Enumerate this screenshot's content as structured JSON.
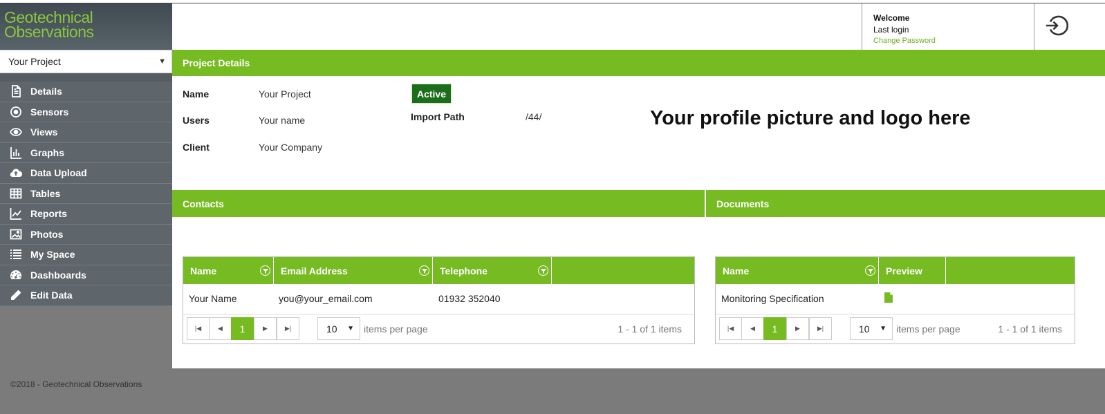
{
  "app": {
    "logo_line1": "Geotechnical",
    "logo_line2": "Observations",
    "footer": "©2018 - Geotechnical Observations"
  },
  "colors": {
    "accent": "#77bb22",
    "status_active": "#1c6d1c",
    "sidebar": "#5e666c",
    "link": "#6fae22"
  },
  "sidebar": {
    "project_select": "Your Project",
    "items": [
      {
        "label": "Details",
        "icon": "document-icon"
      },
      {
        "label": "Sensors",
        "icon": "target-icon"
      },
      {
        "label": "Views",
        "icon": "eye-icon"
      },
      {
        "label": "Graphs",
        "icon": "bar-chart-icon"
      },
      {
        "label": "Data Upload",
        "icon": "cloud-upload-icon"
      },
      {
        "label": "Tables",
        "icon": "table-icon"
      },
      {
        "label": "Reports",
        "icon": "line-chart-icon"
      },
      {
        "label": "Photos",
        "icon": "image-icon"
      },
      {
        "label": "My Space",
        "icon": "list-icon"
      },
      {
        "label": "Dashboards",
        "icon": "dashboard-icon"
      },
      {
        "label": "Edit Data",
        "icon": "pencil-icon"
      }
    ]
  },
  "header": {
    "welcome": "Welcome",
    "last_login": "Last login",
    "change_password": "Change Password",
    "logout_icon": "sign-in-icon"
  },
  "project_details": {
    "title": "Project Details",
    "name_label": "Name",
    "name_value": "Your Project",
    "users_label": "Users",
    "users_value": "Your name",
    "client_label": "Client",
    "client_value": "Your Company",
    "status": "Active",
    "import_path_label": "Import Path",
    "import_path_value": "/44/",
    "profile_placeholder": "Your profile picture and logo here"
  },
  "contacts": {
    "title": "Contacts",
    "columns": [
      "Name",
      "Email Address",
      "Telephone"
    ],
    "rows": [
      {
        "name": "Your Name",
        "email": "you@your_email.com",
        "phone": "01932 352040"
      }
    ],
    "page": "1",
    "page_size": "10",
    "items_per_page": "items per page",
    "info": "1 - 1 of 1 items"
  },
  "documents": {
    "title": "Documents",
    "columns": [
      "Name",
      "Preview"
    ],
    "rows": [
      {
        "name": "Monitoring Specification",
        "preview_icon": "file-icon"
      }
    ],
    "page": "1",
    "page_size": "10",
    "items_per_page": "items per page",
    "info": "1 - 1 of 1 items"
  }
}
